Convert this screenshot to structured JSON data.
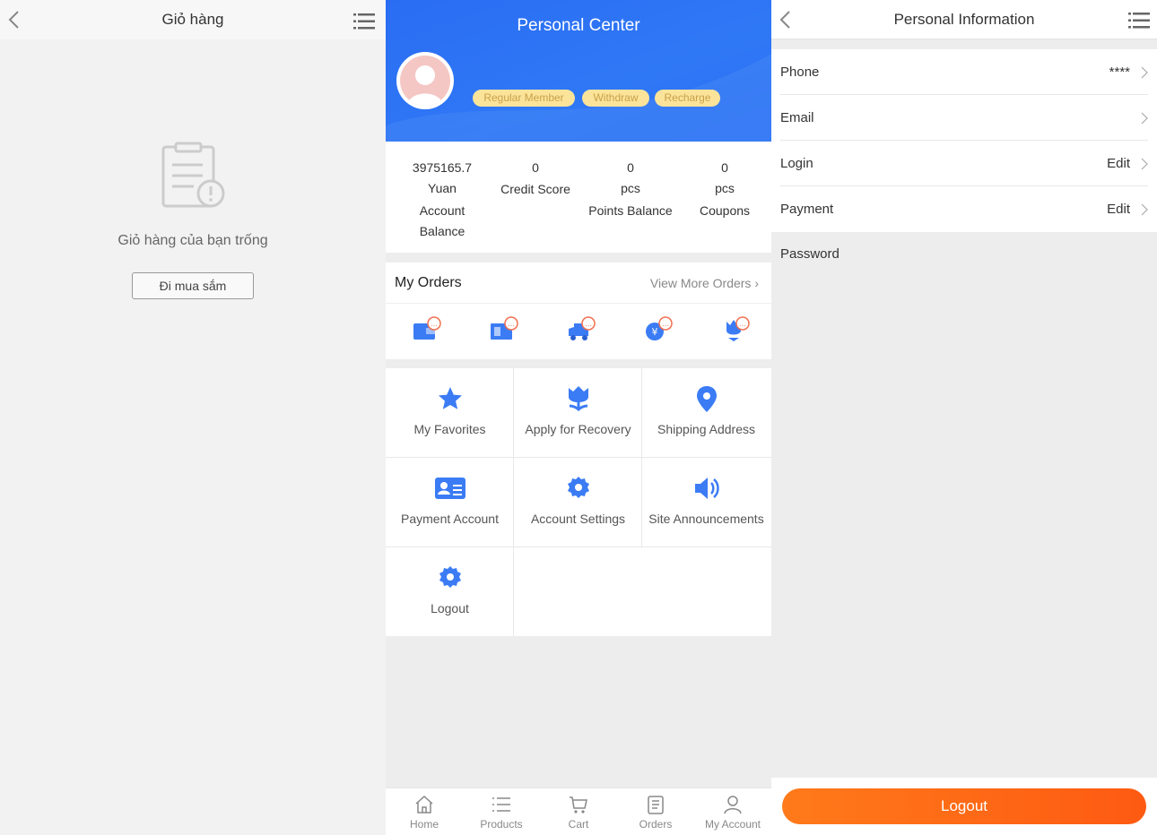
{
  "cart_panel": {
    "title": "Giỏ hàng",
    "empty_text": "Giỏ hàng của bạn trống",
    "shop_button": "Đi mua sắm"
  },
  "personal_center": {
    "title": "Personal Center",
    "badges": [
      "Regular Member",
      "Withdraw",
      "Recharge"
    ],
    "stats": [
      {
        "value": "3975165.7",
        "unit": "Yuan",
        "label1": "Account",
        "label2": "Balance"
      },
      {
        "value": "0",
        "unit": "",
        "label1": "Credit Score",
        "label2": ""
      },
      {
        "value": "0",
        "unit": "pcs",
        "label1": "Points Balance",
        "label2": ""
      },
      {
        "value": "0",
        "unit": "pcs",
        "label1": "Coupons",
        "label2": ""
      }
    ],
    "orders": {
      "label": "My Orders",
      "more": "View More Orders"
    },
    "menu": [
      {
        "label": "My Favorites",
        "icon": "star-icon"
      },
      {
        "label": "Apply for Recovery",
        "icon": "tulip-icon"
      },
      {
        "label": "Shipping Address",
        "icon": "location-pin-icon"
      },
      {
        "label": "Payment Account",
        "icon": "id-card-icon"
      },
      {
        "label": "Account Settings",
        "icon": "gear-icon"
      },
      {
        "label": "Site Announcements",
        "icon": "speaker-icon"
      },
      {
        "label": "Logout",
        "icon": "gear-icon"
      }
    ],
    "tabs": [
      {
        "label": "Home",
        "icon": "home-icon"
      },
      {
        "label": "Products",
        "icon": "list-icon"
      },
      {
        "label": "Cart",
        "icon": "cart-icon"
      },
      {
        "label": "Orders",
        "icon": "clipboard-icon"
      },
      {
        "label": "My Account",
        "icon": "user-icon"
      }
    ],
    "accent": "#2a6df4"
  },
  "personal_info": {
    "title": "Personal Information",
    "rows": [
      {
        "key": "Phone",
        "value": "****"
      },
      {
        "key": "Email",
        "value": ""
      },
      {
        "key": "Login",
        "value": "Edit"
      },
      {
        "key": "Payment",
        "value": "Edit"
      }
    ],
    "password_label": "Password",
    "logout": "Logout",
    "logout_color": "#ff6a14"
  }
}
